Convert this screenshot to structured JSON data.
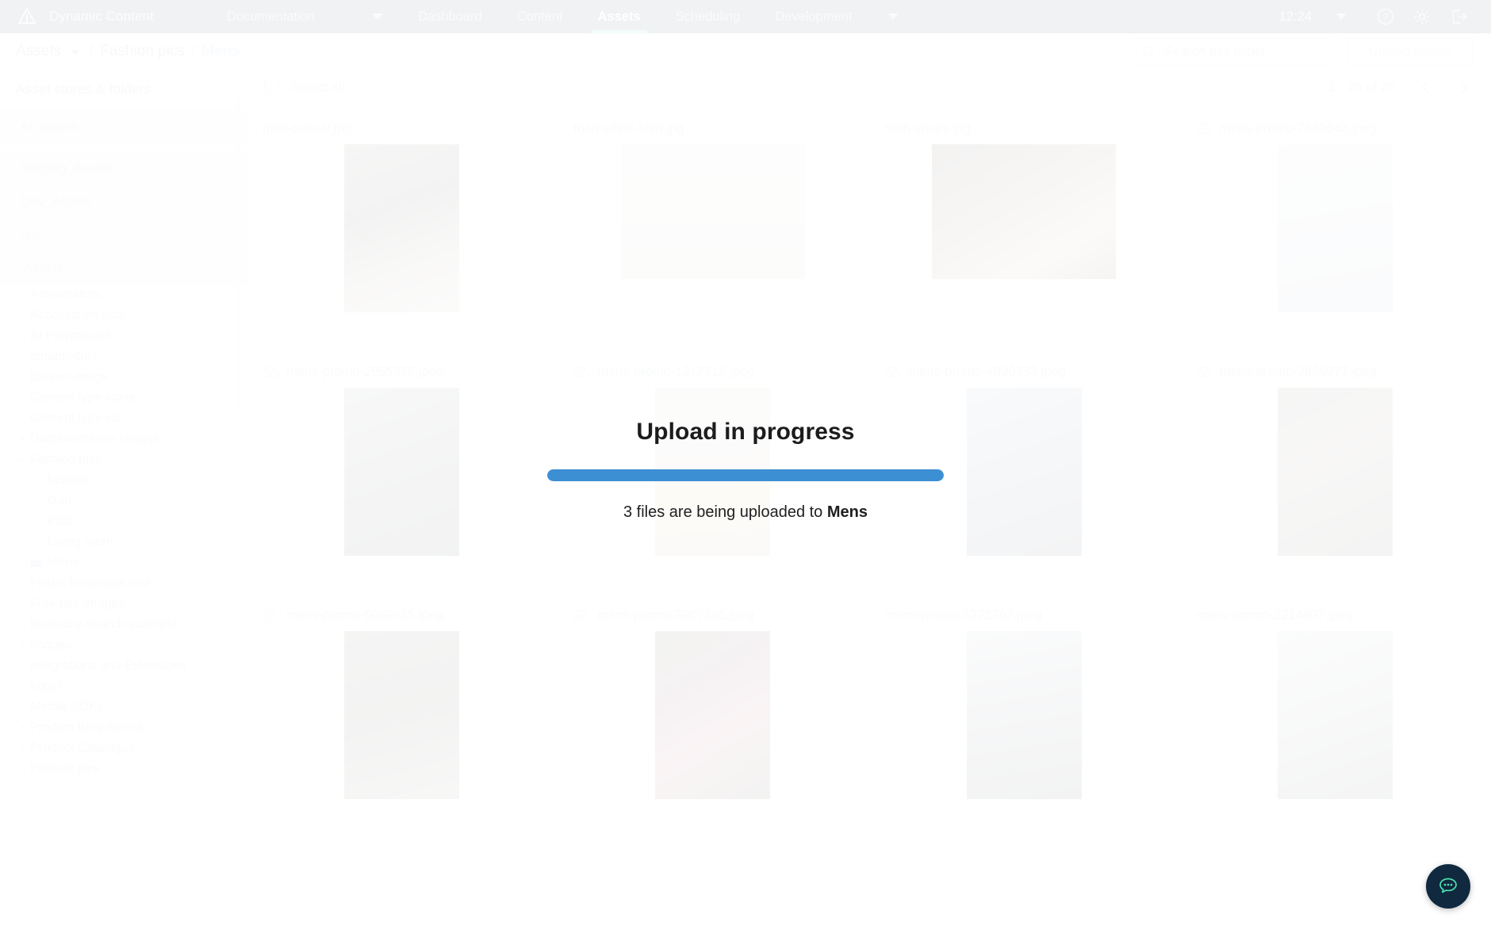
{
  "topnav": {
    "brand": "Dynamic Content",
    "items": [
      {
        "label": "Documentation",
        "caret": true,
        "active": false
      },
      {
        "label": "Dashboard",
        "caret": false,
        "active": false
      },
      {
        "label": "Content",
        "caret": false,
        "active": false
      },
      {
        "label": "Assets",
        "caret": false,
        "active": true
      },
      {
        "label": "Scheduling",
        "caret": false,
        "active": false
      },
      {
        "label": "Development",
        "caret": false,
        "active": false
      }
    ],
    "clock": "12:24",
    "icons": [
      "help-icon",
      "gear-icon",
      "logout-icon"
    ]
  },
  "breadcrumb": {
    "root": "Assets",
    "parent": "Fashion pics",
    "current": "Mens",
    "separator": "/"
  },
  "search": {
    "placeholder": "Search this folder",
    "value": "",
    "icon": "search-icon"
  },
  "upload_button": {
    "label": "Upload assets",
    "disabled": true
  },
  "sidebar": {
    "title": "Asset stores & folders",
    "stores": [
      {
        "label": "All assets",
        "expandable": false
      },
      {
        "label": "Staging_Assets",
        "expandable": false
      },
      {
        "label": "Dev_Assets",
        "expandable": false
      },
      {
        "label": "ugc",
        "expandable": false
      },
      {
        "label": "Assets",
        "expandable": true,
        "expanded": true
      }
    ],
    "folders": [
      {
        "label": "Accelerators",
        "depth": 1,
        "chev": "none"
      },
      {
        "label": "Accessories pics",
        "depth": 1,
        "chev": "none"
      },
      {
        "label": "AI Playground",
        "depth": 1,
        "chev": "none"
      },
      {
        "label": "ampproduct",
        "depth": 1,
        "chev": "none"
      },
      {
        "label": "banner-image",
        "depth": 1,
        "chev": "none"
      },
      {
        "label": "Content type icons",
        "depth": 1,
        "chev": "none"
      },
      {
        "label": "Content type viz",
        "depth": 1,
        "chev": "none"
      },
      {
        "label": "Documentation images",
        "depth": 1,
        "chev": "right"
      },
      {
        "label": "Fashion pics",
        "depth": 1,
        "chev": "down"
      },
      {
        "label": "fashion",
        "depth": 2,
        "chev": "none"
      },
      {
        "label": "Gap",
        "depth": 2,
        "chev": "none"
      },
      {
        "label": "Kids",
        "depth": 2,
        "chev": "none"
      },
      {
        "label": "Living room",
        "depth": 2,
        "chev": "none"
      },
      {
        "label": "Mens",
        "depth": 2,
        "chev": "none",
        "selected": true,
        "icon": "folder-icon"
      },
      {
        "label": "Folder behaviour test",
        "depth": 1,
        "chev": "none"
      },
      {
        "label": "Free use images",
        "depth": 1,
        "chev": "none"
      },
      {
        "label": "hierarchy-search-example",
        "depth": 1,
        "chev": "none"
      },
      {
        "label": "Images",
        "depth": 1,
        "chev": "right"
      },
      {
        "label": "Integrations and Extensions",
        "depth": 1,
        "chev": "none"
      },
      {
        "label": "Login",
        "depth": 1,
        "chev": "none"
      },
      {
        "label": "Mobile SDKs",
        "depth": 1,
        "chev": "none"
      },
      {
        "label": "Product Blog Assets",
        "depth": 1,
        "chev": "right"
      },
      {
        "label": "Product Catalogue",
        "depth": 1,
        "chev": "right"
      },
      {
        "label": "Product pics",
        "depth": 1,
        "chev": "none"
      }
    ]
  },
  "toolbar": {
    "select_all_label": "Select all",
    "pagination": "1 - 26 of 26",
    "prev_icon": "chevron-left-icon",
    "next_icon": "chevron-right-icon"
  },
  "assets": [
    {
      "name": "man-casual.jpg",
      "cloud": false,
      "shape": "tall",
      "tone": "ph-a"
    },
    {
      "name": "man-white-shirt.jpg",
      "cloud": false,
      "shape": "wide",
      "tone": "ph-b"
    },
    {
      "name": "man-shoes.jpg",
      "cloud": false,
      "shape": "wide",
      "tone": "ph-c"
    },
    {
      "name": "mens-promo-7562643.jpeg",
      "cloud": true,
      "shape": "tall",
      "tone": "ph-d"
    },
    {
      "name": "mens-promo-2955375.jpeg",
      "cloud": true,
      "shape": "tall",
      "tone": "ph-e"
    },
    {
      "name": "mens-promo-1317712.jpeg",
      "cloud": true,
      "shape": "tall",
      "tone": "ph-f"
    },
    {
      "name": "mens-promo-4890733.jpeg",
      "cloud": true,
      "shape": "tall",
      "tone": "ph-g"
    },
    {
      "name": "mens-promo-2866077.jpeg",
      "cloud": true,
      "shape": "tall",
      "tone": "ph-h"
    },
    {
      "name": "mens-promo-6069955.jpeg",
      "cloud": true,
      "shape": "tall",
      "tone": "ph-i"
    },
    {
      "name": "mens-promo-3907595.jpeg",
      "cloud": true,
      "shape": "tall",
      "tone": "ph-j"
    },
    {
      "name": "mens-promo-5372767.jpeg",
      "cloud": false,
      "shape": "tall",
      "tone": "ph-k"
    },
    {
      "name": "mens-promo-3214807.jpeg",
      "cloud": false,
      "shape": "tall",
      "tone": "ph-l"
    }
  ],
  "modal": {
    "title": "Upload in progress",
    "progress_percent": 100,
    "message_prefix": "3 files are being uploaded to ",
    "message_target": "Mens"
  },
  "chat": {
    "icon": "chat-bubble-icon",
    "label": "Open support chat"
  },
  "colors": {
    "nav_background": "#17293c",
    "nav_active_underline": "#4ddfae",
    "progress_fill": "#3d8fd4",
    "link_accent": "#a9c9ea",
    "cloud_icon": "#cfe8b4",
    "chat_fab": "#10293f",
    "chat_icon": "#4ddfae"
  }
}
